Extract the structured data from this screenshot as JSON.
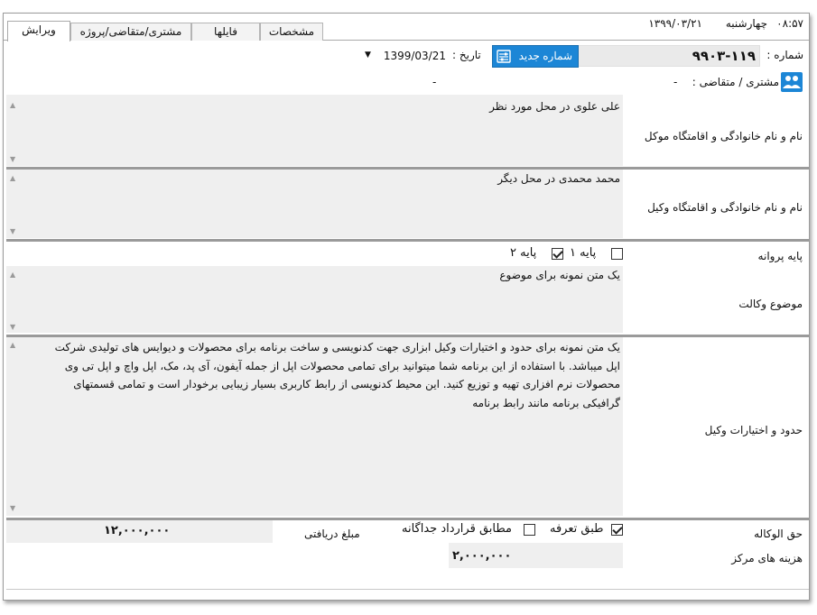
{
  "status": {
    "time": "۰۸:۵۷",
    "day": "چهارشنبه",
    "date": "۱۳۹۹/۰۳/۲۱"
  },
  "tabs": [
    {
      "label": "ویرایش",
      "active": true
    },
    {
      "label": "مشتری/متقاضی/پروژه",
      "active": false
    },
    {
      "label": "فایلها",
      "active": false
    },
    {
      "label": "مشخصات",
      "active": false
    }
  ],
  "header": {
    "number_label": "شماره :",
    "number_value": "۹۹۰۳-۱۱۹",
    "new_number_button": "شماره جدید",
    "date_label": "تاریخ :",
    "date_value": "1399/03/21",
    "client_label": "مشتری / متقاضی :",
    "client_value": "-",
    "client_extra": "-"
  },
  "fields": {
    "client_name_label": "نام و نام خانوادگی و اقامتگاه موکل",
    "client_name_value": "علی علوی در محل مورد نظر",
    "lawyer_name_label": "نام و نام خانوادگی و اقامتگاه وکیل",
    "lawyer_name_value": "محمد محمدی در محل دیگر",
    "license_label": "پایه پروانه",
    "license_options": [
      {
        "label": "پایه ۱",
        "checked": false
      },
      {
        "label": "پایه ۲",
        "checked": true
      }
    ],
    "subject_label": "موضوع وکالت",
    "subject_value": "یک متن نمونه برای موضوع",
    "powers_label": "حدود و اختیارات وکیل",
    "powers_lines": [
      "یک متن نمونه برای حدود و اختیارات وکیل  ابزاری جهت کدنویسی و ساخت برنامه برای محصولات و دیوایس های تولیدی شرکت",
      "اپل میباشد. با استفاده از این برنامه شما میتوانید برای تمامی محصولات اپل از جمله آیفون، آی پد، مک، اپل واچ و اپل تی وی",
      "محصولات نرم افزاری تهیه و توزیع کنید. این محیط کدنویسی از رابط کاربری بسیار زیبایی برخودار است و تمامی قسمتهای",
      "گرافیکی برنامه مانند رابط برنامه"
    ],
    "fee_label": "حق الوکاله",
    "fee_options": [
      {
        "label": "طبق تعرفه",
        "checked": true
      },
      {
        "label": "مطابق قرارداد جداگانه",
        "checked": false
      }
    ],
    "received_label": "مبلغ دریافتی",
    "received_value": "۱۲,۰۰۰,۰۰۰",
    "center_cost_label": "هزینه های مرکز",
    "center_cost_value": "۲,۰۰۰,۰۰۰"
  },
  "colors": {
    "accent": "#1c86d6",
    "field_bg": "#efefef",
    "divider": "#9a9a9a"
  }
}
